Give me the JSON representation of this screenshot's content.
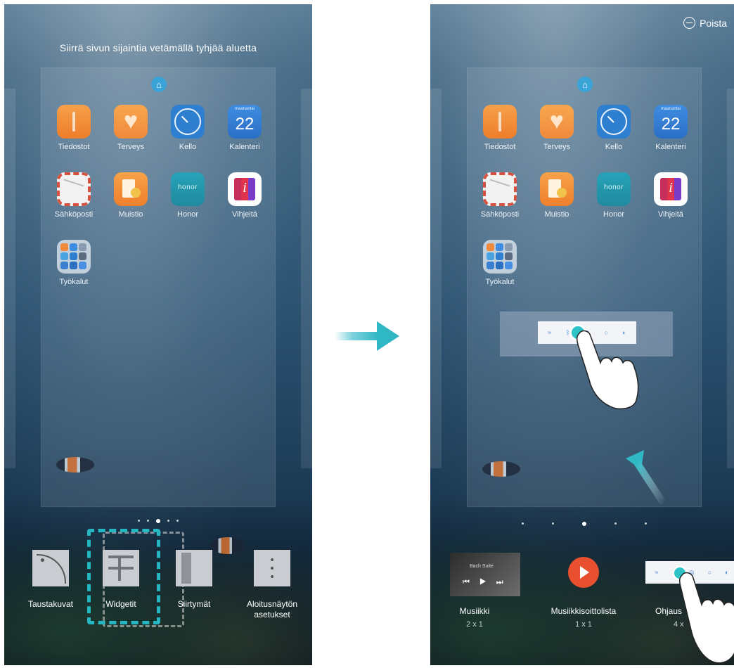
{
  "left_screen": {
    "hint": "Siirrä sivun sijaintia vetämällä tyhjää aluetta",
    "apps": [
      {
        "label": "Tiedostot",
        "icon": "files-icon"
      },
      {
        "label": "Terveys",
        "icon": "health-icon"
      },
      {
        "label": "Kello",
        "icon": "clock-icon"
      },
      {
        "label": "Kalenteri",
        "icon": "calendar-icon"
      },
      {
        "label": "Sähköposti",
        "icon": "email-icon"
      },
      {
        "label": "Muistio",
        "icon": "notepad-icon"
      },
      {
        "label": "Honor",
        "icon": "honor-icon"
      },
      {
        "label": "Vihjeitä",
        "icon": "tips-icon"
      },
      {
        "label": "Työkalut",
        "icon": "tools-folder-icon"
      }
    ],
    "calendar": {
      "weekday": "maanantai",
      "day": "22"
    },
    "honor_logo": "honor",
    "tips_glyph": "i",
    "edit_menu": [
      {
        "label": "Taustakuvat",
        "icon": "wallpaper-icon"
      },
      {
        "label": "Widgetit",
        "icon": "widgets-icon"
      },
      {
        "label": "Siirtymät",
        "icon": "transitions-icon"
      },
      {
        "label": "Aloitusnäytön asetukset",
        "icon": "settings-icon"
      }
    ],
    "selected_menu": "Widgetit"
  },
  "right_screen": {
    "delete_label": "Poista",
    "apps": [
      {
        "label": "Tiedostot"
      },
      {
        "label": "Terveys"
      },
      {
        "label": "Kello"
      },
      {
        "label": "Kalenteri"
      },
      {
        "label": "Sähköposti"
      },
      {
        "label": "Muistio"
      },
      {
        "label": "Honor"
      },
      {
        "label": "Vihjeitä"
      },
      {
        "label": "Työkalut"
      }
    ],
    "calendar": {
      "weekday": "maanantai",
      "day": "22"
    },
    "honor_logo": "honor",
    "tips_glyph": "i",
    "widgets": [
      {
        "label": "Musiikki",
        "size": "2 x 1",
        "preview_title": "Bach Suite"
      },
      {
        "label": "Musiikkisoittolista",
        "size": "1 x 1"
      },
      {
        "label": "Ohjaus",
        "size": "4 x"
      }
    ]
  },
  "colors": {
    "accent": "#2fb7c4",
    "play_button": "#e8502f"
  }
}
